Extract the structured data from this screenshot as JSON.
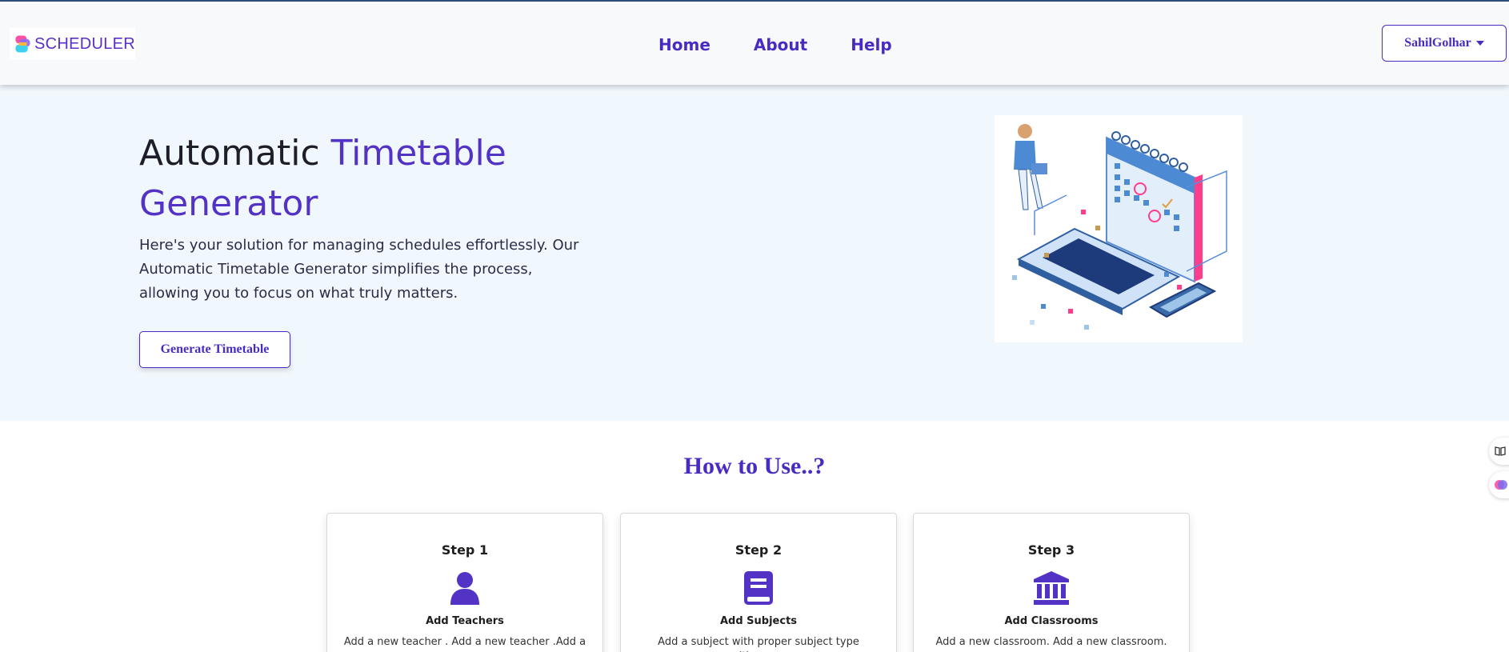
{
  "brand": {
    "name": "SCHEDULER",
    "logo_icon": "scheduler-logo-icon"
  },
  "nav": {
    "items": [
      "Home",
      "About",
      "Help"
    ]
  },
  "user": {
    "name": "SahilGolhar"
  },
  "hero": {
    "title_part1": "Automatic ",
    "title_accent": "Timetable Generator",
    "description": "Here's your solution for managing schedules effortlessly. Our Automatic Timetable Generator simplifies the process, allowing you to focus on what truly matters.",
    "button": "Generate Timetable",
    "image_icon": "timetable-illustration"
  },
  "how": {
    "title": "How to Use..?",
    "steps": [
      {
        "step": "Step 1",
        "icon": "user-icon",
        "name": "Add Teachers",
        "text": "Add a new teacher . Add a new teacher .Add a"
      },
      {
        "step": "Step 2",
        "icon": "book-icon",
        "name": "Add Subjects",
        "text": "Add a subject with proper subject type (theory,"
      },
      {
        "step": "Step 3",
        "icon": "building-columns-icon",
        "name": "Add Classrooms",
        "text": "Add a new classroom. Add a new classroom."
      }
    ]
  },
  "colors": {
    "accent": "#4a2bc2",
    "hero_bg": "#f1f8fd",
    "navbar_bg": "#f8f9fa"
  }
}
